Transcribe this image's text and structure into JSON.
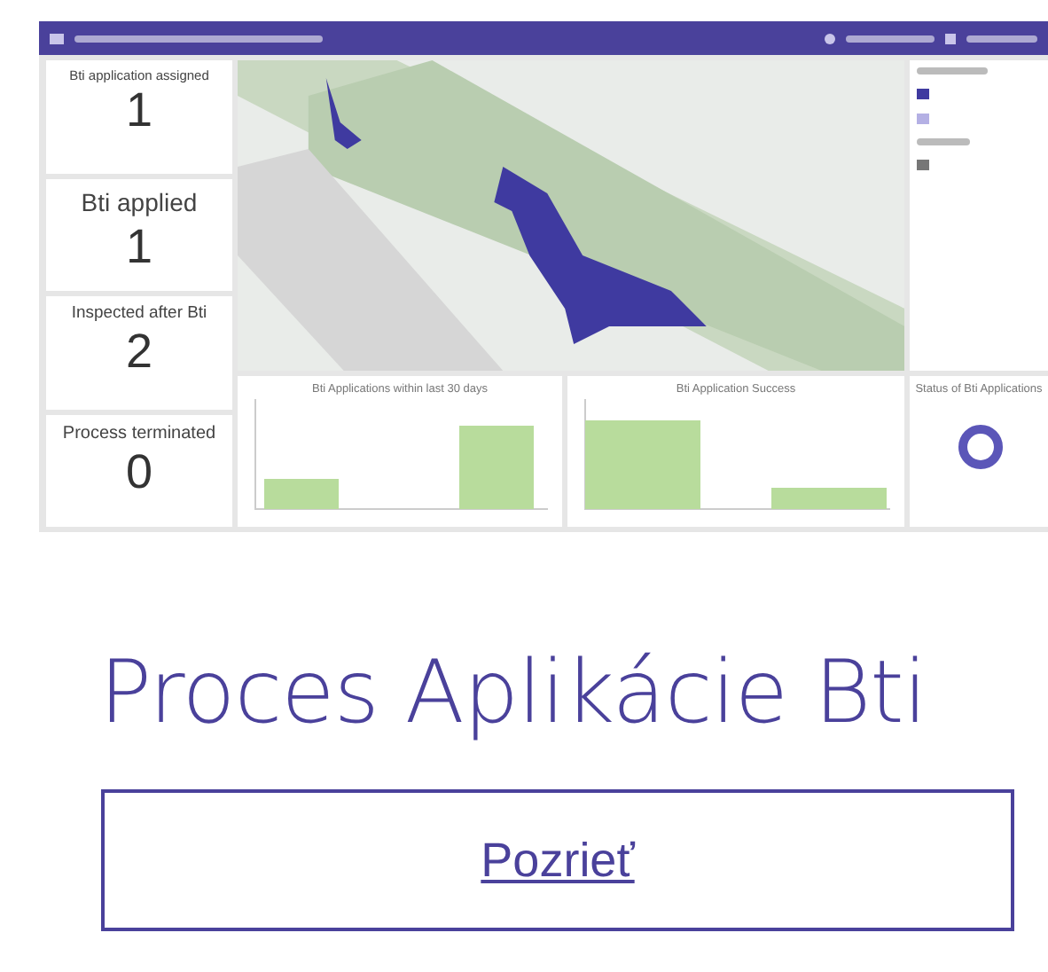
{
  "dashboard": {
    "indicators": [
      {
        "label": "Bti application assigned",
        "value": "1"
      },
      {
        "label": "Bti applied",
        "value": "1"
      },
      {
        "label": "Inspected after Bti",
        "value": "2"
      },
      {
        "label": "Process terminated",
        "value": "0"
      }
    ],
    "charts": [
      {
        "title": "Bti Applications within last 30 days"
      },
      {
        "title": "Bti Application Success"
      },
      {
        "title": "Status of Bti Applications"
      }
    ]
  },
  "heading": "Proces Aplikácie Bti",
  "button": {
    "label": "Pozrieť"
  }
}
